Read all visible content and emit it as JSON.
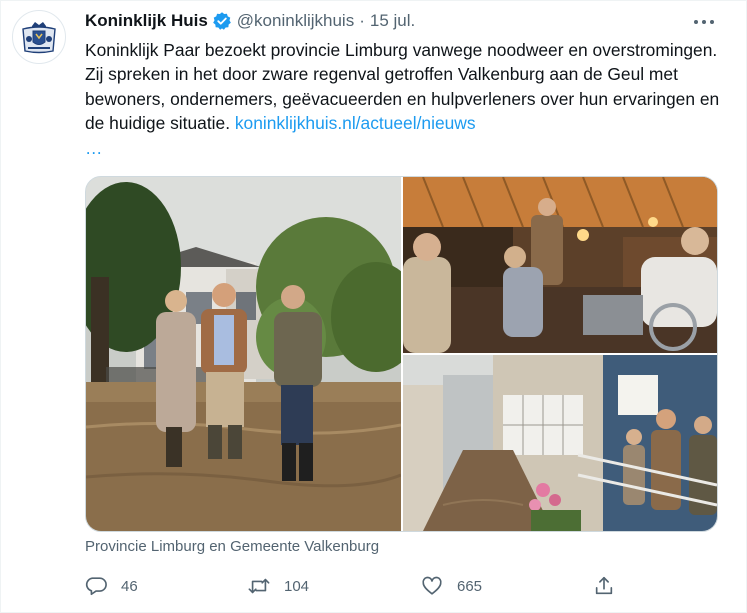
{
  "tweet": {
    "author_name": "Koninklijk Huis",
    "handle": "@koninklijkhuis",
    "separator": "·",
    "date": "15 jul.",
    "text": "Koninklijk Paar bezoekt provincie Limburg vanwege noodweer en overstromingen. Zij spreken in het door zware regenval getroffen Valkenburg aan de Geul met bewoners, ondernemers, geëvacueerden en hulpverleners over hun ervaringen en de huidige situatie. ",
    "link": "koninklijkhuis.nl/actueel/nieuws",
    "ellipsis": "…",
    "caption": "Provincie Limburg en Gemeente Valkenburg",
    "reply_count": "46",
    "retweet_count": "104",
    "like_count": "665"
  },
  "icons": {
    "avatar": "royal-coat-of-arms-icon",
    "verified": "verified-badge-icon",
    "more": "more-dots-icon",
    "reply": "reply-bubble-icon",
    "retweet": "retweet-icon",
    "like": "heart-icon",
    "share": "share-icon"
  },
  "colors": {
    "accent": "#1d9bf0",
    "text": "#0f1419",
    "secondary": "#536471"
  }
}
